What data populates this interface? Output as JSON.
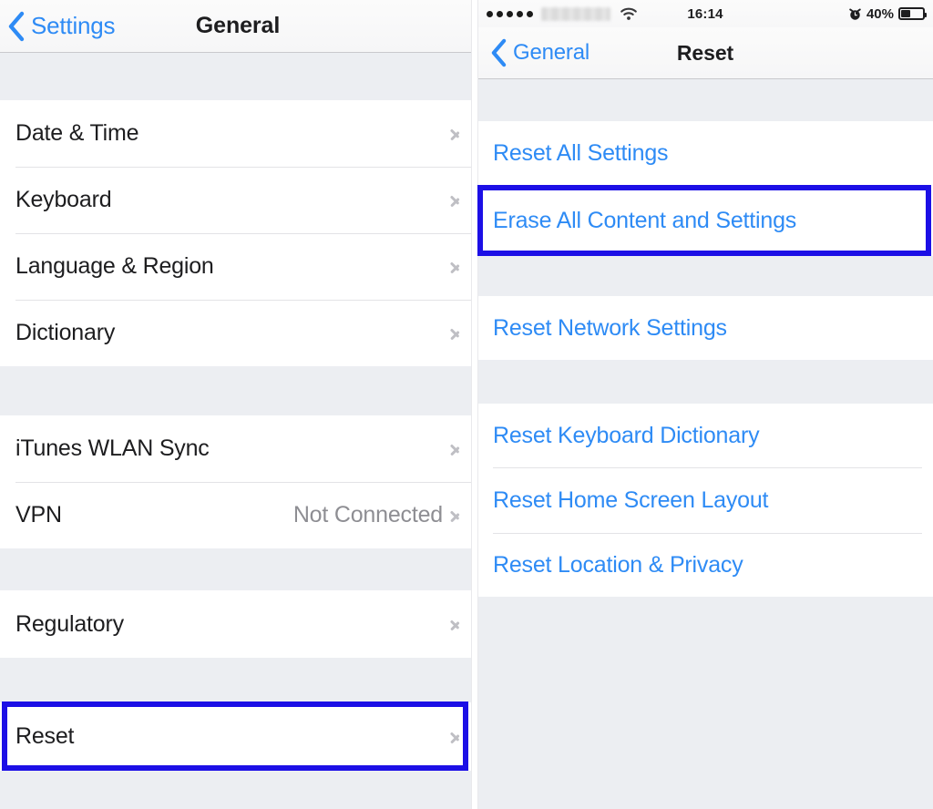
{
  "left_panel": {
    "nav": {
      "back_label": "Settings",
      "back_icon": "chevron-left-icon",
      "title": "General"
    },
    "groups": [
      {
        "rows": [
          {
            "label": "Date & Time",
            "value": "",
            "accessory": "chevron-right-icon"
          },
          {
            "label": "Keyboard",
            "value": "",
            "accessory": "chevron-right-icon"
          },
          {
            "label": "Language & Region",
            "value": "",
            "accessory": "chevron-right-icon"
          },
          {
            "label": "Dictionary",
            "value": "",
            "accessory": "chevron-right-icon"
          }
        ]
      },
      {
        "rows": [
          {
            "label": "iTunes WLAN Sync",
            "value": "",
            "accessory": "chevron-right-icon"
          },
          {
            "label": "VPN",
            "value": "Not Connected",
            "accessory": "chevron-right-icon"
          }
        ]
      },
      {
        "rows": [
          {
            "label": "Regulatory",
            "value": "",
            "accessory": "chevron-right-icon"
          }
        ]
      },
      {
        "rows": [
          {
            "label": "Reset",
            "value": "",
            "accessory": "chevron-right-icon",
            "highlighted": true
          }
        ]
      }
    ]
  },
  "right_panel": {
    "status_bar": {
      "signal_dots": 5,
      "carrier": "",
      "wifi_icon": "wifi-icon",
      "time": "16:14",
      "alarm_icon": "alarm-clock-icon",
      "battery_percent": "40%",
      "battery_icon": "battery-icon",
      "battery_level": 40
    },
    "nav": {
      "back_label": "General",
      "back_icon": "chevron-left-icon",
      "title": "Reset"
    },
    "groups": [
      {
        "rows": [
          {
            "label": "Reset All Settings"
          },
          {
            "label": "Erase All Content and Settings",
            "highlighted": true
          }
        ]
      },
      {
        "rows": [
          {
            "label": "Reset Network Settings"
          }
        ]
      },
      {
        "rows": [
          {
            "label": "Reset Keyboard Dictionary"
          },
          {
            "label": "Reset Home Screen Layout"
          },
          {
            "label": "Reset Location & Privacy"
          }
        ]
      }
    ]
  },
  "annotations": {
    "highlight_color": "#1c0fe6",
    "boxes": [
      {
        "target": "Reset",
        "panel": "left"
      },
      {
        "target": "Erase All Content and Settings",
        "panel": "right"
      }
    ]
  },
  "colors": {
    "tint_blue": "#2e8bf5",
    "text_primary": "#1d1d1f",
    "text_secondary": "#8e8e93",
    "group_background": "#eceef2",
    "row_background": "#ffffff",
    "highlight": "#1c0fe6"
  }
}
